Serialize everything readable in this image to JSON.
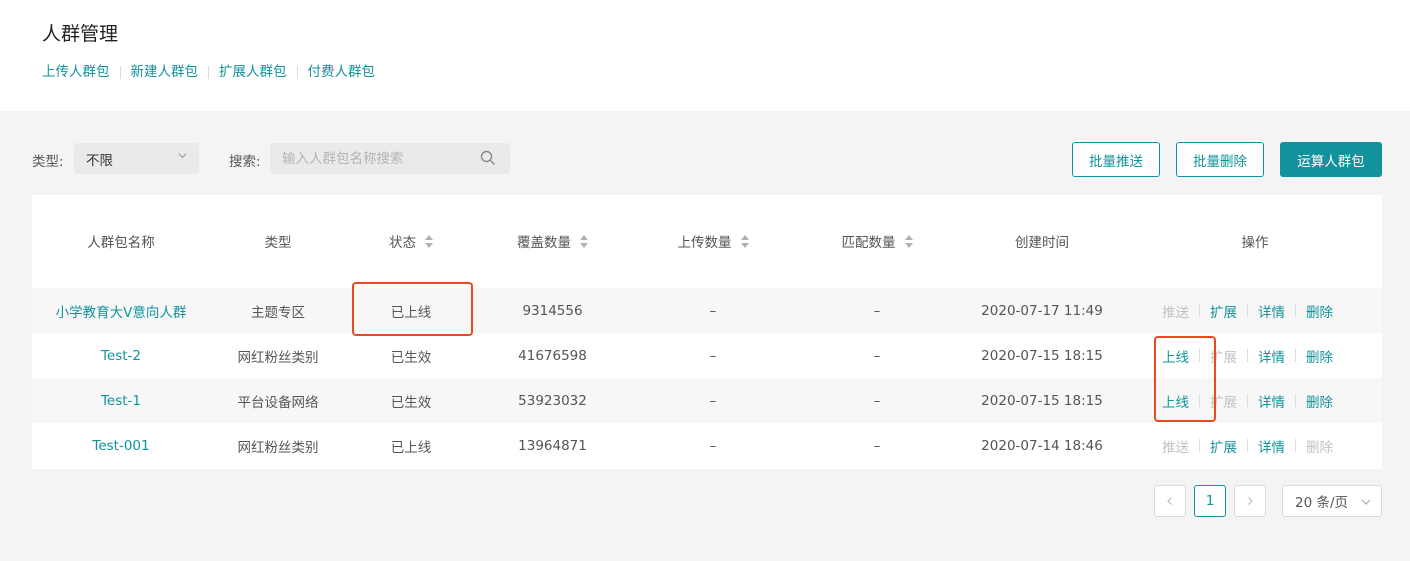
{
  "header": {
    "title": "人群管理",
    "tabs": [
      "上传人群包",
      "新建人群包",
      "扩展人群包",
      "付费人群包"
    ]
  },
  "filters": {
    "type_label": "类型:",
    "type_value": "不限",
    "search_label": "搜索:",
    "search_placeholder": "输入人群包名称搜索"
  },
  "toolbar": {
    "batch_push": "批量推送",
    "batch_delete": "批量删除",
    "compute": "运算人群包"
  },
  "table": {
    "columns": {
      "name": "人群包名称",
      "type": "类型",
      "status": "状态",
      "coverage": "覆盖数量",
      "upload": "上传数量",
      "match": "匹配数量",
      "created": "创建时间",
      "actions": "操作"
    },
    "rows": [
      {
        "name": "小学教育大V意向人群",
        "type": "主题专区",
        "status": "已上线",
        "coverage": "9314556",
        "upload": "–",
        "match": "–",
        "created": "2020-07-17 11:49",
        "actions": [
          {
            "label": "推送",
            "enabled": false
          },
          {
            "label": "扩展",
            "enabled": true
          },
          {
            "label": "详情",
            "enabled": true
          },
          {
            "label": "删除",
            "enabled": true
          }
        ]
      },
      {
        "name": "Test-2",
        "type": "网红粉丝类别",
        "status": "已生效",
        "coverage": "41676598",
        "upload": "–",
        "match": "–",
        "created": "2020-07-15 18:15",
        "actions": [
          {
            "label": "上线",
            "enabled": true
          },
          {
            "label": "扩展",
            "enabled": false
          },
          {
            "label": "详情",
            "enabled": true
          },
          {
            "label": "删除",
            "enabled": true
          }
        ]
      },
      {
        "name": "Test-1",
        "type": "平台设备网络",
        "status": "已生效",
        "coverage": "53923032",
        "upload": "–",
        "match": "–",
        "created": "2020-07-15 18:15",
        "actions": [
          {
            "label": "上线",
            "enabled": true
          },
          {
            "label": "扩展",
            "enabled": false
          },
          {
            "label": "详情",
            "enabled": true
          },
          {
            "label": "删除",
            "enabled": true
          }
        ]
      },
      {
        "name": "Test-001",
        "type": "网红粉丝类别",
        "status": "已上线",
        "coverage": "13964871",
        "upload": "–",
        "match": "–",
        "created": "2020-07-14 18:46",
        "actions": [
          {
            "label": "推送",
            "enabled": false
          },
          {
            "label": "扩展",
            "enabled": true
          },
          {
            "label": "详情",
            "enabled": true
          },
          {
            "label": "删除",
            "enabled": false
          }
        ]
      }
    ]
  },
  "pagination": {
    "current_page": "1",
    "page_size": "20 条/页"
  },
  "colors": {
    "accent": "#12939c",
    "highlight": "#e84c1e",
    "disabled": "#c2c2c2"
  }
}
